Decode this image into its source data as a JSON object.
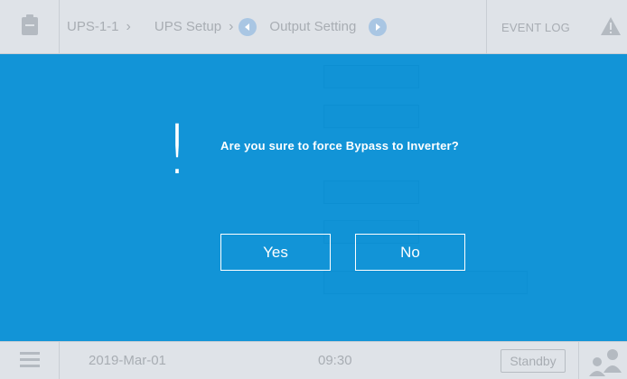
{
  "header": {
    "breadcrumbs": [
      "UPS-1-1",
      "UPS Setup",
      "Output Setting"
    ],
    "event_log_label": "EVENT LOG"
  },
  "dialog": {
    "message": "Are you sure to force Bypass to Inverter?",
    "yes_label": "Yes",
    "no_label": "No",
    "background_color": "#008cd4"
  },
  "footer": {
    "date": "2019-Mar-01",
    "time": "09:30",
    "status": "Standby"
  },
  "icons": [
    "home-icon",
    "chevron-right-icon",
    "left-arrow-circle-icon",
    "right-arrow-circle-icon",
    "warning-icon",
    "menu-icon",
    "user-icon",
    "exclamation-icon"
  ]
}
